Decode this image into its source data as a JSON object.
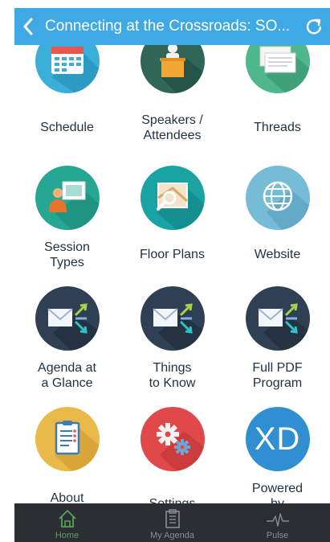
{
  "header": {
    "title": "Connecting at the Crossroads: SO...",
    "back_icon": "chevron-left-icon",
    "refresh_icon": "refresh-icon",
    "color": "#3fa9e6"
  },
  "tiles": [
    {
      "label": "Schedule",
      "icon": "calendar-icon",
      "color": "#3aaed8"
    },
    {
      "label": "Speakers /\nAttendees",
      "icon": "podium-speaker-icon",
      "color": "#2f6656"
    },
    {
      "label": "Threads",
      "icon": "threads-icon",
      "color": "#4fb78e"
    },
    {
      "label": "Session\nTypes",
      "icon": "presenter-icon",
      "color": "#26a793"
    },
    {
      "label": "Floor Plans",
      "icon": "map-magnifier-icon",
      "color": "#1aa3a3"
    },
    {
      "label": "Website",
      "icon": "globe-icon",
      "color": "#77bcd6"
    },
    {
      "label": "Agenda at\na Glance",
      "icon": "mail-arrows-icon",
      "color": "#2f4055"
    },
    {
      "label": "Things\nto Know",
      "icon": "mail-arrows-icon",
      "color": "#2f4055"
    },
    {
      "label": "Full PDF\nProgram",
      "icon": "mail-arrows-icon",
      "color": "#2f4055"
    },
    {
      "label": "About\nEvent",
      "icon": "clipboard-icon",
      "color": "#e9b949"
    },
    {
      "label": "Settings",
      "icon": "gears-icon",
      "color": "#e0484a"
    },
    {
      "label": "Powered\nby",
      "icon": "xd-logo",
      "logo_text": "XD",
      "color": "#2f8fd0"
    }
  ],
  "tabs": [
    {
      "label": "Home",
      "icon": "home-icon",
      "active": true
    },
    {
      "label": "My Agenda",
      "icon": "agenda-icon",
      "active": false
    },
    {
      "label": "Pulse",
      "icon": "pulse-icon",
      "active": false
    }
  ]
}
